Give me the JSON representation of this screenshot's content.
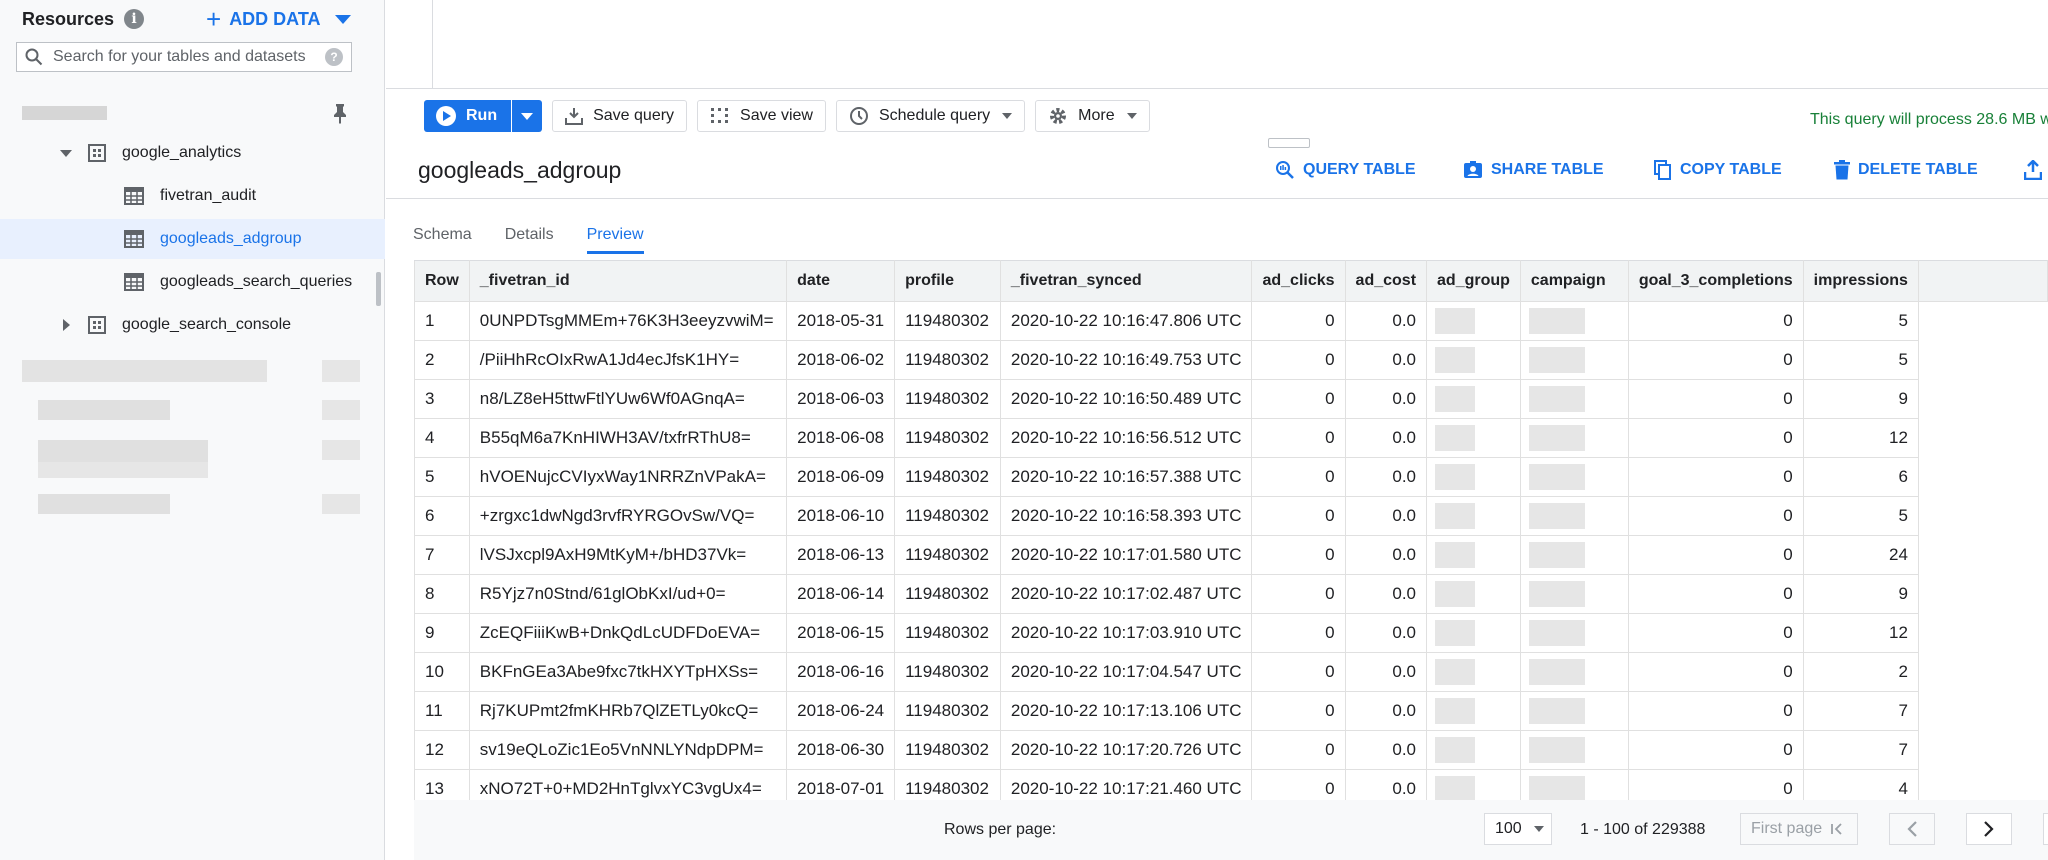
{
  "sidebar": {
    "title": "Resources",
    "add_data": "ADD DATA",
    "search_placeholder": "Search for your tables and datasets",
    "tree": [
      {
        "label": "google_analytics",
        "type": "dataset",
        "expanded": true
      },
      {
        "label": "fivetran_audit",
        "type": "table"
      },
      {
        "label": "googleads_adgroup",
        "type": "table",
        "selected": true
      },
      {
        "label": "googleads_search_queries",
        "type": "table"
      },
      {
        "label": "google_search_console",
        "type": "dataset",
        "expanded": false
      }
    ]
  },
  "toolbar": {
    "run": "Run",
    "save_query": "Save query",
    "save_view": "Save view",
    "schedule_query": "Schedule query",
    "more": "More",
    "process_message": "This query will process 28.6 MB w"
  },
  "table_header": {
    "title": "googleads_adgroup",
    "actions": {
      "query": "QUERY TABLE",
      "share": "SHARE TABLE",
      "copy": "COPY TABLE",
      "delete": "DELETE TABLE"
    }
  },
  "tabs": [
    "Schema",
    "Details",
    "Preview"
  ],
  "grid": {
    "columns": [
      "Row",
      "_fivetran_id",
      "date",
      "profile",
      "_fivetran_synced",
      "ad_clicks",
      "ad_cost",
      "ad_group",
      "campaign",
      "goal_3_completions",
      "impressions"
    ],
    "rows": [
      [
        "1",
        "0UNPDTsgMMEm+76K3H3eeyzvwiM=",
        "2018-05-31",
        "119480302",
        "2020-10-22 10:16:47.806 UTC",
        "0",
        "0.0",
        "",
        "",
        "0",
        "5"
      ],
      [
        "2",
        "/PiiHhRcOIxRwA1Jd4ecJfsK1HY=",
        "2018-06-02",
        "119480302",
        "2020-10-22 10:16:49.753 UTC",
        "0",
        "0.0",
        "",
        "",
        "0",
        "5"
      ],
      [
        "3",
        "n8/LZ8eH5ttwFtlYUw6Wf0AGnqA=",
        "2018-06-03",
        "119480302",
        "2020-10-22 10:16:50.489 UTC",
        "0",
        "0.0",
        "",
        "",
        "0",
        "9"
      ],
      [
        "4",
        "B55qM6a7KnHIWH3AV/txfrRThU8=",
        "2018-06-08",
        "119480302",
        "2020-10-22 10:16:56.512 UTC",
        "0",
        "0.0",
        "",
        "",
        "0",
        "12"
      ],
      [
        "5",
        "hVOENujcCVIyxWay1NRRZnVPakA=",
        "2018-06-09",
        "119480302",
        "2020-10-22 10:16:57.388 UTC",
        "0",
        "0.0",
        "",
        "",
        "0",
        "6"
      ],
      [
        "6",
        "+zrgxc1dwNgd3rvfRYRGOvSw/VQ=",
        "2018-06-10",
        "119480302",
        "2020-10-22 10:16:58.393 UTC",
        "0",
        "0.0",
        "",
        "",
        "0",
        "5"
      ],
      [
        "7",
        "lVSJxcpl9AxH9MtKyM+/bHD37Vk=",
        "2018-06-13",
        "119480302",
        "2020-10-22 10:17:01.580 UTC",
        "0",
        "0.0",
        "",
        "",
        "0",
        "24"
      ],
      [
        "8",
        "R5Yjz7n0Stnd/61glObKxI/ud+0=",
        "2018-06-14",
        "119480302",
        "2020-10-22 10:17:02.487 UTC",
        "0",
        "0.0",
        "",
        "",
        "0",
        "9"
      ],
      [
        "9",
        "ZcEQFiiiKwB+DnkQdLcUDFDoEVA=",
        "2018-06-15",
        "119480302",
        "2020-10-22 10:17:03.910 UTC",
        "0",
        "0.0",
        "",
        "",
        "0",
        "12"
      ],
      [
        "10",
        "BKFnGEa3Abe9fxc7tkHXYTpHXSs=",
        "2018-06-16",
        "119480302",
        "2020-10-22 10:17:04.547 UTC",
        "0",
        "0.0",
        "",
        "",
        "0",
        "2"
      ],
      [
        "11",
        "Rj7KUPmt2fmKHRb7QlZETLy0kcQ=",
        "2018-06-24",
        "119480302",
        "2020-10-22 10:17:13.106 UTC",
        "0",
        "0.0",
        "",
        "",
        "0",
        "7"
      ],
      [
        "12",
        "sv19eQLoZic1Eo5VnNNLYNdpDPM=",
        "2018-06-30",
        "119480302",
        "2020-10-22 10:17:20.726 UTC",
        "0",
        "0.0",
        "",
        "",
        "0",
        "7"
      ],
      [
        "13",
        "xNO72T+0+MD2HnTglvxYC3vgUx4=",
        "2018-07-01",
        "119480302",
        "2020-10-22 10:17:21.460 UTC",
        "0",
        "0.0",
        "",
        "",
        "0",
        "4"
      ]
    ]
  },
  "footer": {
    "rows_per_page_label": "Rows per page:",
    "rows_per_page_value": "100",
    "range": "1 - 100 of 229388",
    "first_page": "First page"
  },
  "colors": {
    "accent": "#1a73e8",
    "success": "#188038",
    "selected_bg": "#e8f0fe"
  }
}
